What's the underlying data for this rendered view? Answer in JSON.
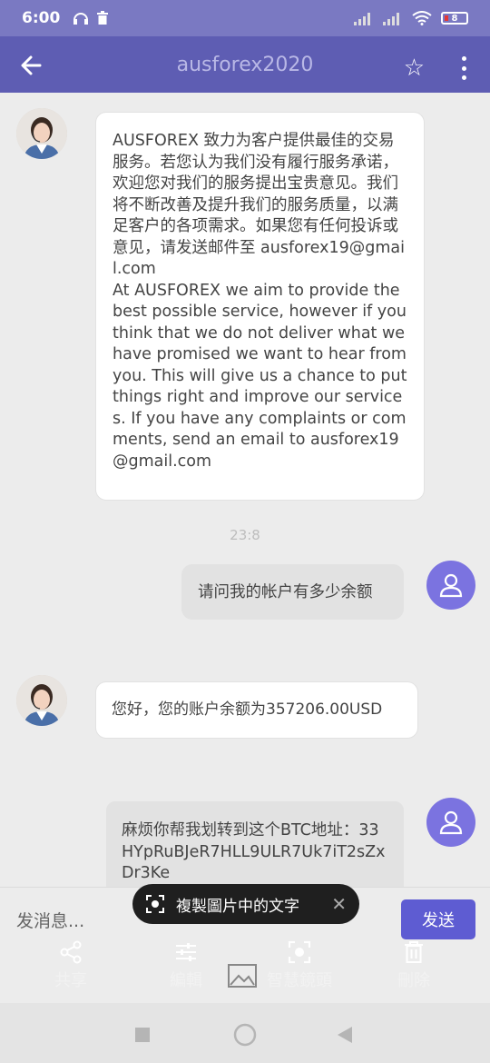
{
  "status_bar": {
    "time": "6:00",
    "battery": "8"
  },
  "header": {
    "title": "ausforex2020"
  },
  "messages": [
    {
      "text": "AUSFOREX 致力为客户提供最佳的交易服务。若您认为我们没有履行服务承诺，欢迎您对我们的服务提出宝贵意见。我们将不断改善及提升我们的服务质量，以满足客户的各项需求。如果您有任何投诉或意见，请发送邮件至 ausforex19@gmail.com\nAt AUSFOREX we aim to provide the best possible service, however if you think that we do not deliver what we have promised we want to hear from you. This will give us a chance to put things right and improve our services. If you have any complaints or comments, send an email to ausforex19@gmail.com"
    },
    {
      "text": "请问我的帐户有多少余额"
    },
    {
      "text": "您好，您的账户余额为357206.00USD"
    },
    {
      "text": "麻烦你帮我划转到这个BTC地址：33HYpRuBJeR7HLL9ULR7Uk7iT2sZxDr3Ke"
    }
  ],
  "timestamp": "23:8",
  "input": {
    "placeholder": "发消息...",
    "send_label": "发送"
  },
  "overlay": {
    "label": "複製圖片中的文字"
  },
  "toolbar": {
    "share": "共享",
    "edit": "編輯",
    "smart_lens": "智慧鏡頭",
    "delete": "刪除"
  },
  "colors": {
    "header": "#5e5db3",
    "accent": "#7b73e0",
    "send": "#5e5cd2"
  }
}
